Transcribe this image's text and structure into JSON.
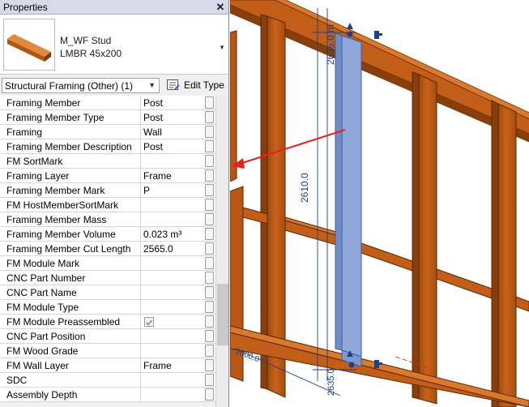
{
  "panel": {
    "title": "Properties",
    "close_glyph": "✕",
    "type_name": "M_WF Stud",
    "type_subname": "LMBR 45x200",
    "filter_label": "Structural Framing (Other) (1)",
    "edit_type_label": "Edit Type"
  },
  "properties": [
    {
      "name": "Framing Member",
      "value": "Post"
    },
    {
      "name": "Framing Member Type",
      "value": "Post"
    },
    {
      "name": "Framing",
      "value": "Wall"
    },
    {
      "name": "Framing Member Description",
      "value": "Post"
    },
    {
      "name": "FM SortMark",
      "value": ""
    },
    {
      "name": "Framing Layer",
      "value": "Frame"
    },
    {
      "name": "Framing Member Mark",
      "value": "P"
    },
    {
      "name": "FM HostMemberSortMark",
      "value": ""
    },
    {
      "name": "Framing Member Mass",
      "value": ""
    },
    {
      "name": "Framing Member Volume",
      "value": "0.023 m³"
    },
    {
      "name": "Framing Member Cut Length",
      "value": "2565.0"
    },
    {
      "name": "FM Module Mark",
      "value": ""
    },
    {
      "name": "CNC Part Number",
      "value": ""
    },
    {
      "name": "CNC Part Name",
      "value": ""
    },
    {
      "name": "FM Module Type",
      "value": ""
    },
    {
      "name": "FM Module Preassembled",
      "value": "",
      "checkbox": true,
      "checked": true
    },
    {
      "name": "CNC Part Position",
      "value": ""
    },
    {
      "name": "FM Wood Grade",
      "value": ""
    },
    {
      "name": "FM Wall Layer",
      "value": "Frame"
    },
    {
      "name": "SDC",
      "value": ""
    },
    {
      "name": "Assembly Depth",
      "value": ""
    }
  ],
  "viewport": {
    "dim_top": "2635.0 m",
    "dim_mid": "2610.0",
    "dim_bottom": "2635.0",
    "dim_left": "2000.0",
    "colors": {
      "timber": "#c25e17",
      "timber_dark": "#8a3f0a",
      "timber_light": "#d9792e",
      "selection": "#8ea6d8",
      "selection_edge": "#3d5fa8",
      "arrow": "#e8201a",
      "dimension": "#1f3f8a"
    }
  }
}
